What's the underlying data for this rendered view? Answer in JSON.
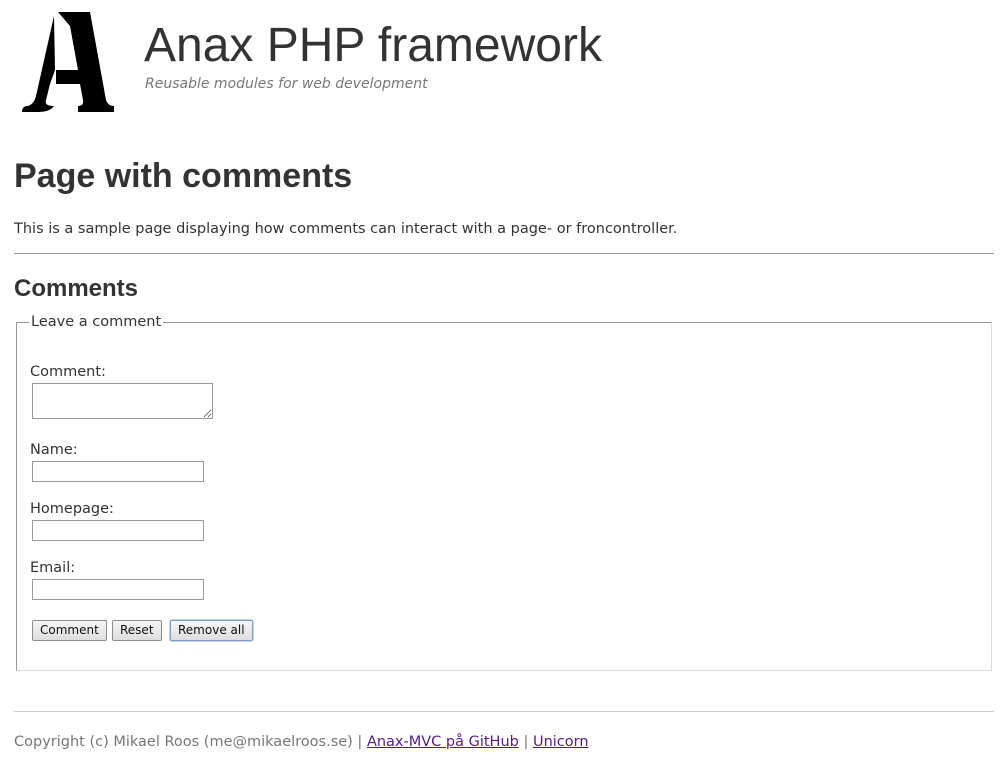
{
  "header": {
    "site_title": "Anax PHP framework",
    "site_slogan": "Reusable modules for web development",
    "logo_icon": "anax-logo-icon"
  },
  "main": {
    "page_title": "Page with comments",
    "intro": "This is a sample page displaying how comments can interact with a page- or froncontroller.",
    "comments_heading": "Comments"
  },
  "form": {
    "legend": "Leave a comment",
    "comment_label": "Comment:",
    "comment_value": "",
    "name_label": "Name:",
    "name_value": "",
    "homepage_label": "Homepage:",
    "homepage_value": "",
    "email_label": "Email:",
    "email_value": "",
    "buttons": {
      "comment": "Comment",
      "reset": "Reset",
      "remove_all": "Remove all"
    }
  },
  "footer": {
    "copyright": "Copyright (c) Mikael Roos (me@mikaelroos.se) | ",
    "github_link": "Anax-MVC på GitHub",
    "separator": " | ",
    "unicorn_link": "Unicorn"
  },
  "colors": {
    "text": "#333333",
    "muted": "#777777",
    "visited_link": "#551a8b"
  }
}
